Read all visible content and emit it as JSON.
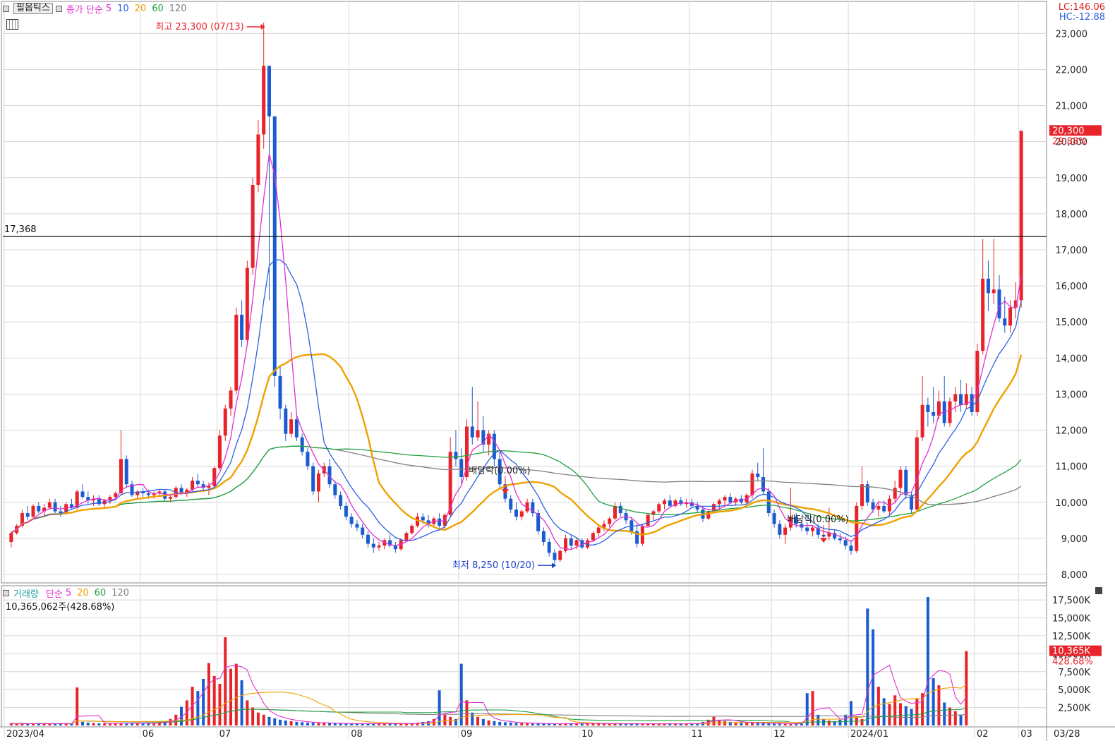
{
  "price_panel": {
    "title_button": "필옵틱스",
    "legend_prefix": "종가 단순",
    "ma_periods": [
      {
        "label": "5",
        "color": "#e030d0"
      },
      {
        "label": "10",
        "color": "#2a62e0"
      },
      {
        "label": "20",
        "color": "#f0a000"
      },
      {
        "label": "60",
        "color": "#20a040"
      },
      {
        "label": "120",
        "color": "#808080"
      }
    ],
    "lc_text": "LC:146.06",
    "hc_text": "HC:-12.88",
    "high_annotation": "최고 23,300 (07/13)",
    "low_annotation": "최저 8,250 (10/20)",
    "dividend_label_1": "배당락(0.00%)",
    "dividend_label_2": "배당락(0.00%)",
    "ref_line_label": "17,368",
    "last_price_label": "20,300",
    "last_change_label": "29.88%"
  },
  "volume_panel": {
    "legend_prefix": "거래량",
    "legend_ma_prefix": "단순",
    "ma_periods": [
      {
        "label": "5",
        "color": "#e030d0"
      },
      {
        "label": "20",
        "color": "#f0a000"
      },
      {
        "label": "60",
        "color": "#20a040"
      },
      {
        "label": "120",
        "color": "#808080"
      }
    ],
    "info_text": "10,365,062주(428.68%)",
    "last_volume_label": "10,365K",
    "last_volume_pct": "428.68%"
  },
  "x_axis": {
    "labels": [
      "2023/04",
      "06",
      "07",
      "08",
      "09",
      "10",
      "11",
      "12",
      "2024/01",
      "02",
      "03"
    ],
    "right_label": "03/28"
  },
  "colors": {
    "up": "#e8232a",
    "down": "#1a5cd0",
    "grid": "#d8d8d8",
    "axis": "#333333",
    "ref_line": "#000000"
  },
  "chart_data": {
    "type": "candlestick",
    "price_axis": {
      "ylim": [
        8000,
        23300
      ],
      "ticks": [
        "8,000",
        "9,000",
        "10,000",
        "11,000",
        "12,000",
        "13,000",
        "14,000",
        "15,000",
        "16,000",
        "17,000",
        "18,000",
        "19,000",
        "20,000",
        "21,000",
        "22,000",
        "23,000"
      ],
      "tick_values": [
        8000,
        9000,
        10000,
        11000,
        12000,
        13000,
        14000,
        15000,
        16000,
        17000,
        18000,
        19000,
        20000,
        21000,
        22000,
        23000
      ]
    },
    "volume_axis": {
      "ylim": [
        0,
        18000
      ],
      "ticks": [
        "2,500K",
        "5,000K",
        "7,500K",
        "10,000K",
        "12,500K",
        "15,000K",
        "17,500K"
      ],
      "tick_values": [
        2500,
        5000,
        7500,
        10000,
        12500,
        15000,
        17500
      ]
    },
    "reference_line": 17368,
    "high": {
      "value": 23300,
      "date": "07/13"
    },
    "low": {
      "value": 8250,
      "date": "10/20"
    },
    "last": {
      "close": 20300,
      "change_pct": 29.88,
      "volume": 10365062
    },
    "candles_note": "OHLC sequence estimated from the chart, oldest to newest",
    "ohlc": [
      [
        8900,
        9200,
        8750,
        9150
      ],
      [
        9150,
        9400,
        9100,
        9350
      ],
      [
        9350,
        9800,
        9300,
        9700
      ],
      [
        9700,
        9900,
        9500,
        9600
      ],
      [
        9600,
        9950,
        9550,
        9900
      ],
      [
        9900,
        10000,
        9700,
        9750
      ],
      [
        9750,
        9950,
        9600,
        9850
      ],
      [
        9850,
        10100,
        9800,
        10000
      ],
      [
        10000,
        10100,
        9700,
        9750
      ],
      [
        9750,
        9900,
        9600,
        9700
      ],
      [
        9700,
        10000,
        9650,
        9950
      ],
      [
        9950,
        10100,
        9800,
        9850
      ],
      [
        9850,
        10350,
        9800,
        10300
      ],
      [
        10300,
        10500,
        10100,
        10150
      ],
      [
        10150,
        10300,
        9950,
        10050
      ],
      [
        10050,
        10200,
        9900,
        10100
      ],
      [
        10100,
        10200,
        9900,
        9950
      ],
      [
        9950,
        10100,
        9850,
        10050
      ],
      [
        10050,
        10200,
        9950,
        10150
      ],
      [
        10150,
        10300,
        10050,
        10250
      ],
      [
        10250,
        12000,
        10200,
        11200
      ],
      [
        11200,
        11300,
        10400,
        10500
      ],
      [
        10500,
        10600,
        10150,
        10200
      ],
      [
        10200,
        10350,
        10100,
        10300
      ],
      [
        10300,
        10400,
        10150,
        10250
      ],
      [
        10250,
        10350,
        10100,
        10200
      ],
      [
        10200,
        10300,
        10100,
        10250
      ],
      [
        10250,
        10350,
        10150,
        10300
      ],
      [
        10300,
        10350,
        10050,
        10100
      ],
      [
        10100,
        10200,
        10000,
        10150
      ],
      [
        10150,
        10450,
        10100,
        10400
      ],
      [
        10400,
        10500,
        10200,
        10250
      ],
      [
        10250,
        10400,
        10150,
        10350
      ],
      [
        10350,
        10700,
        10300,
        10600
      ],
      [
        10600,
        10800,
        10400,
        10500
      ],
      [
        10500,
        10600,
        10300,
        10400
      ],
      [
        10400,
        10550,
        10200,
        10450
      ],
      [
        10450,
        11000,
        10400,
        10950
      ],
      [
        10950,
        12000,
        10900,
        11850
      ],
      [
        11850,
        12700,
        11700,
        12600
      ],
      [
        12600,
        13200,
        12400,
        13100
      ],
      [
        13100,
        15400,
        13000,
        15200
      ],
      [
        15200,
        15600,
        14300,
        14500
      ],
      [
        14500,
        16700,
        14400,
        16500
      ],
      [
        16500,
        19000,
        16300,
        18800
      ],
      [
        18800,
        20600,
        18600,
        20200
      ],
      [
        20200,
        23300,
        19800,
        22100
      ],
      [
        22100,
        21600,
        15600,
        20700
      ],
      [
        20700,
        14100,
        13200,
        13500
      ],
      [
        13500,
        13800,
        12300,
        12600
      ],
      [
        12600,
        12700,
        11700,
        11900
      ],
      [
        11900,
        12500,
        11800,
        12300
      ],
      [
        12300,
        12400,
        11700,
        11800
      ],
      [
        11800,
        11900,
        11300,
        11400
      ],
      [
        11400,
        11500,
        10900,
        11000
      ],
      [
        11000,
        11100,
        10200,
        10300
      ],
      [
        10300,
        10900,
        10000,
        10800
      ],
      [
        10800,
        11100,
        10700,
        11000
      ],
      [
        11000,
        11200,
        10400,
        10500
      ],
      [
        10500,
        10600,
        10100,
        10200
      ],
      [
        10200,
        10300,
        9800,
        9900
      ],
      [
        9900,
        10000,
        9500,
        9600
      ],
      [
        9600,
        9700,
        9300,
        9400
      ],
      [
        9400,
        9500,
        9200,
        9300
      ],
      [
        9300,
        9400,
        9000,
        9100
      ],
      [
        9100,
        9200,
        8750,
        8850
      ],
      [
        8850,
        9000,
        8600,
        8750
      ],
      [
        8750,
        8900,
        8650,
        8800
      ],
      [
        8800,
        9000,
        8700,
        8950
      ],
      [
        8950,
        9100,
        8750,
        8800
      ],
      [
        8800,
        8900,
        8600,
        8700
      ],
      [
        8700,
        9000,
        8650,
        8950
      ],
      [
        8950,
        9200,
        8900,
        9150
      ],
      [
        9150,
        9400,
        9100,
        9350
      ],
      [
        9350,
        9700,
        9300,
        9600
      ],
      [
        9600,
        9700,
        9400,
        9500
      ],
      [
        9500,
        9650,
        9300,
        9400
      ],
      [
        9400,
        9600,
        9350,
        9550
      ],
      [
        9550,
        9700,
        9300,
        9350
      ],
      [
        9350,
        9700,
        9250,
        9650
      ],
      [
        9650,
        11800,
        9600,
        11400
      ],
      [
        11400,
        12000,
        11000,
        11200
      ],
      [
        11200,
        11500,
        10500,
        10700
      ],
      [
        10700,
        12300,
        10600,
        12100
      ],
      [
        12100,
        13200,
        11600,
        11800
      ],
      [
        11800,
        12800,
        11700,
        12000
      ],
      [
        12000,
        12400,
        11400,
        11600
      ],
      [
        11600,
        12000,
        11300,
        11900
      ],
      [
        11900,
        12000,
        11000,
        11200
      ],
      [
        11200,
        11400,
        10400,
        10500
      ],
      [
        10500,
        10600,
        10000,
        10100
      ],
      [
        10100,
        10200,
        9700,
        9800
      ],
      [
        9800,
        10000,
        9500,
        9600
      ],
      [
        9600,
        9800,
        9500,
        9750
      ],
      [
        9750,
        10100,
        9700,
        10000
      ],
      [
        10000,
        10100,
        9600,
        9700
      ],
      [
        9700,
        9800,
        9100,
        9200
      ],
      [
        9200,
        9300,
        8800,
        8900
      ],
      [
        8900,
        9000,
        8500,
        8600
      ],
      [
        8600,
        8700,
        8250,
        8400
      ],
      [
        8400,
        8700,
        8350,
        8650
      ],
      [
        8650,
        9100,
        8600,
        9000
      ],
      [
        9000,
        9100,
        8700,
        8800
      ],
      [
        8800,
        9000,
        8700,
        8950
      ],
      [
        8950,
        9000,
        8700,
        8750
      ],
      [
        8750,
        9000,
        8700,
        8950
      ],
      [
        8950,
        9200,
        8900,
        9150
      ],
      [
        9150,
        9400,
        9050,
        9300
      ],
      [
        9300,
        9500,
        9200,
        9400
      ],
      [
        9400,
        9600,
        9300,
        9550
      ],
      [
        9550,
        10000,
        9500,
        9900
      ],
      [
        9900,
        10000,
        9600,
        9700
      ],
      [
        9700,
        9800,
        9400,
        9500
      ],
      [
        9500,
        9600,
        9100,
        9200
      ],
      [
        9200,
        9400,
        8750,
        8850
      ],
      [
        8850,
        9400,
        8800,
        9350
      ],
      [
        9350,
        9700,
        9300,
        9650
      ],
      [
        9650,
        9800,
        9500,
        9750
      ],
      [
        9750,
        10000,
        9700,
        9950
      ],
      [
        9950,
        10100,
        9800,
        10050
      ],
      [
        10050,
        10200,
        9850,
        9900
      ],
      [
        9900,
        10100,
        9850,
        10050
      ],
      [
        10050,
        10150,
        9900,
        9950
      ],
      [
        9950,
        10100,
        9850,
        10000
      ],
      [
        10000,
        10100,
        9850,
        9900
      ],
      [
        9900,
        10000,
        9700,
        9800
      ],
      [
        9800,
        9900,
        9450,
        9550
      ],
      [
        9550,
        9800,
        9500,
        9750
      ],
      [
        9750,
        10000,
        9700,
        9950
      ],
      [
        9950,
        10100,
        9800,
        10050
      ],
      [
        10050,
        10200,
        9900,
        10150
      ],
      [
        10150,
        10250,
        9950,
        10000
      ],
      [
        10000,
        10150,
        9900,
        10100
      ],
      [
        10100,
        10200,
        9950,
        10000
      ],
      [
        10000,
        10250,
        9950,
        10200
      ],
      [
        10200,
        10900,
        10100,
        10800
      ],
      [
        10800,
        11100,
        10600,
        10700
      ],
      [
        10700,
        11500,
        10200,
        10300
      ],
      [
        10300,
        10400,
        9600,
        9700
      ],
      [
        9700,
        9800,
        9300,
        9400
      ],
      [
        9400,
        9500,
        9000,
        9100
      ],
      [
        9100,
        9400,
        8850,
        9300
      ],
      [
        9300,
        10400,
        9200,
        9600
      ],
      [
        9600,
        9700,
        9300,
        9400
      ],
      [
        9400,
        9500,
        9200,
        9300
      ],
      [
        9300,
        9450,
        9100,
        9200
      ],
      [
        9200,
        9350,
        9050,
        9300
      ],
      [
        9300,
        9400,
        9000,
        9100
      ],
      [
        9100,
        9250,
        8950,
        9050
      ],
      [
        9050,
        9850,
        8950,
        9150
      ],
      [
        9150,
        9250,
        8950,
        9000
      ],
      [
        9000,
        9150,
        8850,
        8950
      ],
      [
        8950,
        9050,
        8700,
        8800
      ],
      [
        8800,
        8950,
        8550,
        8650
      ],
      [
        8650,
        10000,
        8600,
        9900
      ],
      [
        9900,
        11000,
        9800,
        10500
      ],
      [
        10500,
        10600,
        9900,
        10000
      ],
      [
        10000,
        10100,
        9700,
        9800
      ],
      [
        9800,
        10000,
        9600,
        9900
      ],
      [
        9900,
        10050,
        9700,
        9750
      ],
      [
        9750,
        10200,
        9650,
        10100
      ],
      [
        10100,
        10600,
        10000,
        10400
      ],
      [
        10400,
        11000,
        10200,
        10900
      ],
      [
        10900,
        11000,
        10100,
        10200
      ],
      [
        10200,
        10300,
        9700,
        9800
      ],
      [
        9800,
        12000,
        9750,
        11800
      ],
      [
        11800,
        13500,
        11700,
        12700
      ],
      [
        12700,
        12900,
        12100,
        12500
      ],
      [
        12500,
        13200,
        12200,
        12400
      ],
      [
        12400,
        13100,
        12300,
        12800
      ],
      [
        12800,
        13500,
        12100,
        12200
      ],
      [
        12200,
        12900,
        12100,
        12800
      ],
      [
        12800,
        13200,
        12500,
        13000
      ],
      [
        13000,
        13400,
        12500,
        12700
      ],
      [
        12700,
        13300,
        12600,
        13000
      ],
      [
        13000,
        13200,
        12400,
        12500
      ],
      [
        12500,
        14400,
        12400,
        14200
      ],
      [
        14200,
        17300,
        14100,
        16200
      ],
      [
        16200,
        16700,
        15300,
        15800
      ],
      [
        15800,
        17300,
        15500,
        15900
      ],
      [
        15900,
        16300,
        15000,
        15100
      ],
      [
        15100,
        15700,
        14700,
        14900
      ],
      [
        14900,
        15600,
        14700,
        15400
      ],
      [
        15400,
        16100,
        15100,
        15600
      ],
      [
        15600,
        20300,
        15400,
        20300
      ]
    ],
    "volume_k": [
      300,
      250,
      280,
      200,
      260,
      300,
      240,
      220,
      250,
      230,
      260,
      240,
      5300,
      500,
      400,
      350,
      300,
      280,
      260,
      300,
      320,
      340,
      350,
      300,
      280,
      300,
      320,
      400,
      600,
      900,
      1500,
      2600,
      3500,
      5400,
      4800,
      6500,
      8700,
      6900,
      5800,
      12300,
      7900,
      8600,
      6300,
      3500,
      2500,
      1800,
      1500,
      1200,
      1000,
      800,
      700,
      600,
      500,
      450,
      400,
      380,
      350,
      330,
      310,
      300,
      280,
      260,
      250,
      240,
      230,
      300,
      280,
      260,
      250,
      240,
      230,
      250,
      300,
      350,
      400,
      500,
      600,
      900,
      4900,
      1500,
      1200,
      900,
      8600,
      3500,
      1800,
      1200,
      900,
      700,
      600,
      500,
      450,
      400,
      350,
      330,
      300,
      280,
      260,
      250,
      240,
      230,
      260,
      280,
      300,
      320,
      300,
      280,
      270,
      260,
      250,
      240,
      250,
      240,
      230,
      220,
      230,
      240,
      250,
      240,
      230,
      220,
      230,
      240,
      260,
      280,
      300,
      320,
      500,
      800,
      1200,
      800,
      600,
      500,
      450,
      400,
      380,
      350,
      330,
      300,
      280,
      260,
      250,
      240,
      230,
      220,
      230,
      4500,
      4800,
      1500,
      900,
      700,
      600,
      800,
      1500,
      3400,
      1200,
      900,
      16300,
      13400,
      5400,
      3800,
      3000,
      4200,
      3100,
      2700,
      2300,
      3800,
      4500,
      17900,
      6600,
      5600,
      3200,
      2500,
      2000,
      1500,
      10365
    ]
  }
}
